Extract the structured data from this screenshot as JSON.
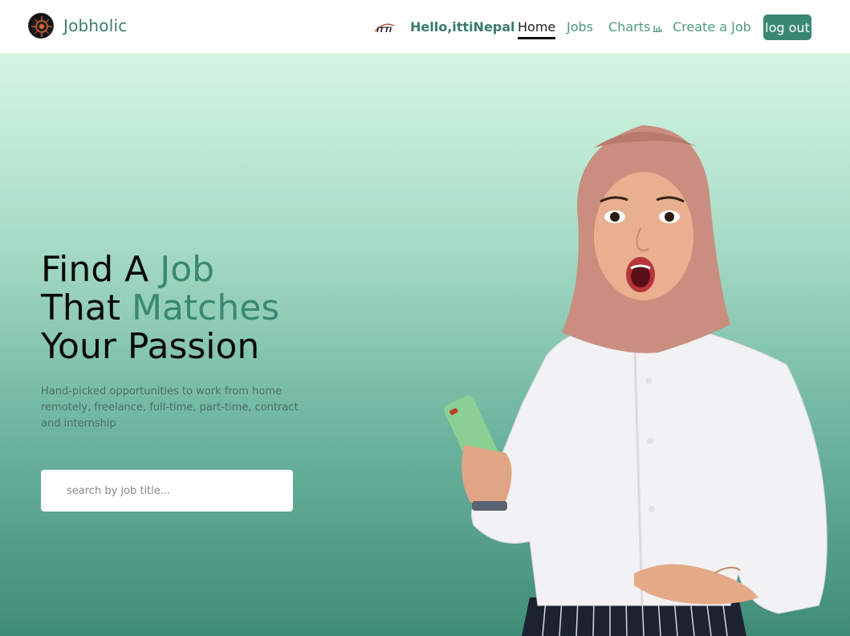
{
  "brand": {
    "name": "Jobholic",
    "logo": "jobholic-logo-icon"
  },
  "header": {
    "partner_logo_text": "ITTI",
    "greeting": "Hello,ittiNepal",
    "nav": {
      "home": "Home",
      "jobs": "Jobs",
      "charts": "Charts",
      "create_job": "Create a Job",
      "logout": "log out"
    },
    "active_nav": "Home",
    "charts_icon": "bar-chart-icon"
  },
  "hero": {
    "headline": {
      "line1_plain": "Find A ",
      "line1_accent": "Job",
      "line2_plain": "That ",
      "line2_accent": "Matches",
      "line3": "Your Passion"
    },
    "subtext": "Hand-picked opportunities to work from home remotely, freelance, full-time, part-time, contract and internship",
    "search": {
      "placeholder": "search by job title...",
      "value": ""
    }
  },
  "colors": {
    "accent": "#3a8874",
    "brand_text": "#3a7d6b",
    "hero_top": "#d4f7e4",
    "hero_bottom": "#3f8c76"
  }
}
